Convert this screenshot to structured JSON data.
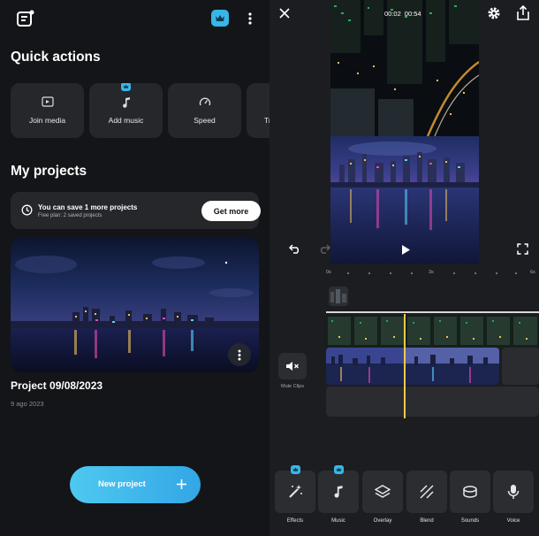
{
  "home": {
    "quick_actions_title": "Quick actions",
    "quick_actions": [
      {
        "label": "Join media",
        "icon": "join-media-icon",
        "premium": false
      },
      {
        "label": "Add music",
        "icon": "music-note-icon",
        "premium": true
      },
      {
        "label": "Speed",
        "icon": "speedometer-icon",
        "premium": false
      },
      {
        "label": "Tr",
        "icon": "trim-icon",
        "premium": false
      }
    ],
    "my_projects_title": "My projects",
    "save_banner": {
      "main": "You can save 1 more projects",
      "sub": "Free plan: 2 saved projects",
      "button": "Get more"
    },
    "project": {
      "name": "Project 09/08/2023",
      "date": "9 ago 2023"
    },
    "new_project_label": "New project"
  },
  "editor": {
    "time_current": "00:02",
    "time_total": "00:54",
    "ruler": {
      "start": "0s",
      "mid": "3s",
      "end": "6s"
    },
    "mute_label": "Mute Clips",
    "tools": [
      {
        "label": "Effects",
        "icon": "magic-wand-icon",
        "premium": true
      },
      {
        "label": "Music",
        "icon": "music-note-icon",
        "premium": true
      },
      {
        "label": "Overlay",
        "icon": "layers-icon",
        "premium": false
      },
      {
        "label": "Blend",
        "icon": "blend-icon",
        "premium": false
      },
      {
        "label": "Sounds",
        "icon": "drum-icon",
        "premium": false
      },
      {
        "label": "Voice",
        "icon": "microphone-icon",
        "premium": false
      }
    ]
  },
  "colors": {
    "accent": "#38b6e8",
    "playhead": "#f2c94c",
    "card": "#25272b",
    "background": "#141518"
  }
}
